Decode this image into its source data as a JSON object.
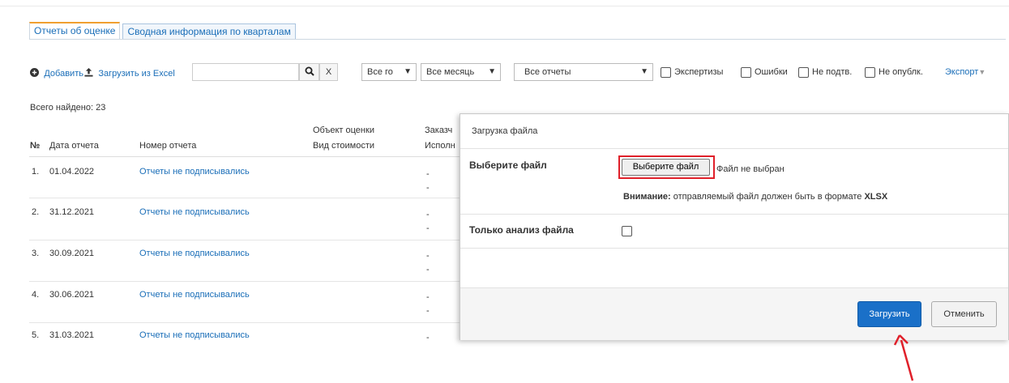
{
  "tabs": [
    {
      "label": "Отчеты об оценке",
      "active": true
    },
    {
      "label": "Сводная информация по кварталам",
      "active": false
    }
  ],
  "toolbar": {
    "add_label": "Добавить",
    "add_icon": "plus-circle-icon",
    "upload_excel_label": "Загрузить из Excel",
    "upload_icon": "upload-icon",
    "search_value": "",
    "search_icon": "search-icon",
    "clear_label": "X",
    "year_select": "Все го",
    "month_select": "Все месяць",
    "reports_select": "Все отчеты",
    "filters": [
      "Экспертизы",
      "Ошибки",
      "Не подтв.",
      "Не опублк."
    ],
    "export_label": "Экспорт"
  },
  "table": {
    "total_found": "Всего найдено: 23",
    "headers": {
      "num": "№",
      "date": "Дата отчета",
      "number": "Номер отчета",
      "object_line1": "Объект оценки",
      "object_line2": "Вид стоимости",
      "customer_line1": "Заказч",
      "customer_line2": "Исполн"
    },
    "rows": [
      {
        "num": "1.",
        "date": "01.04.2022",
        "number": "Отчеты не подписывались",
        "c1": "-",
        "c2": "-"
      },
      {
        "num": "2.",
        "date": "31.12.2021",
        "number": "Отчеты не подписывались",
        "c1": "-",
        "c2": "-"
      },
      {
        "num": "3.",
        "date": "30.09.2021",
        "number": "Отчеты не подписывались",
        "c1": "-",
        "c2": "-"
      },
      {
        "num": "4.",
        "date": "30.06.2021",
        "number": "Отчеты не подписывались",
        "c1": "-",
        "c2": "-"
      },
      {
        "num": "5.",
        "date": "31.03.2021",
        "number": "Отчеты не подписывались",
        "c1": "-",
        "c2": ""
      }
    ]
  },
  "modal": {
    "title": "Загрузка файла",
    "choose_file_label": "Выберите файл",
    "file_button": "Выберите файл",
    "file_none": "Файл не выбран",
    "warning_bold": "Внимание:",
    "warning_text": " отправляемый файл должен быть в формате ",
    "warning_format": "XLSX",
    "analysis_label": "Только анализ файла",
    "submit_label": "Загрузить",
    "cancel_label": "Отменить"
  },
  "colors": {
    "link": "#1a6eb8",
    "primary": "#1a70c8",
    "highlight": "#e0202a",
    "tab_accent": "#f0a030"
  }
}
